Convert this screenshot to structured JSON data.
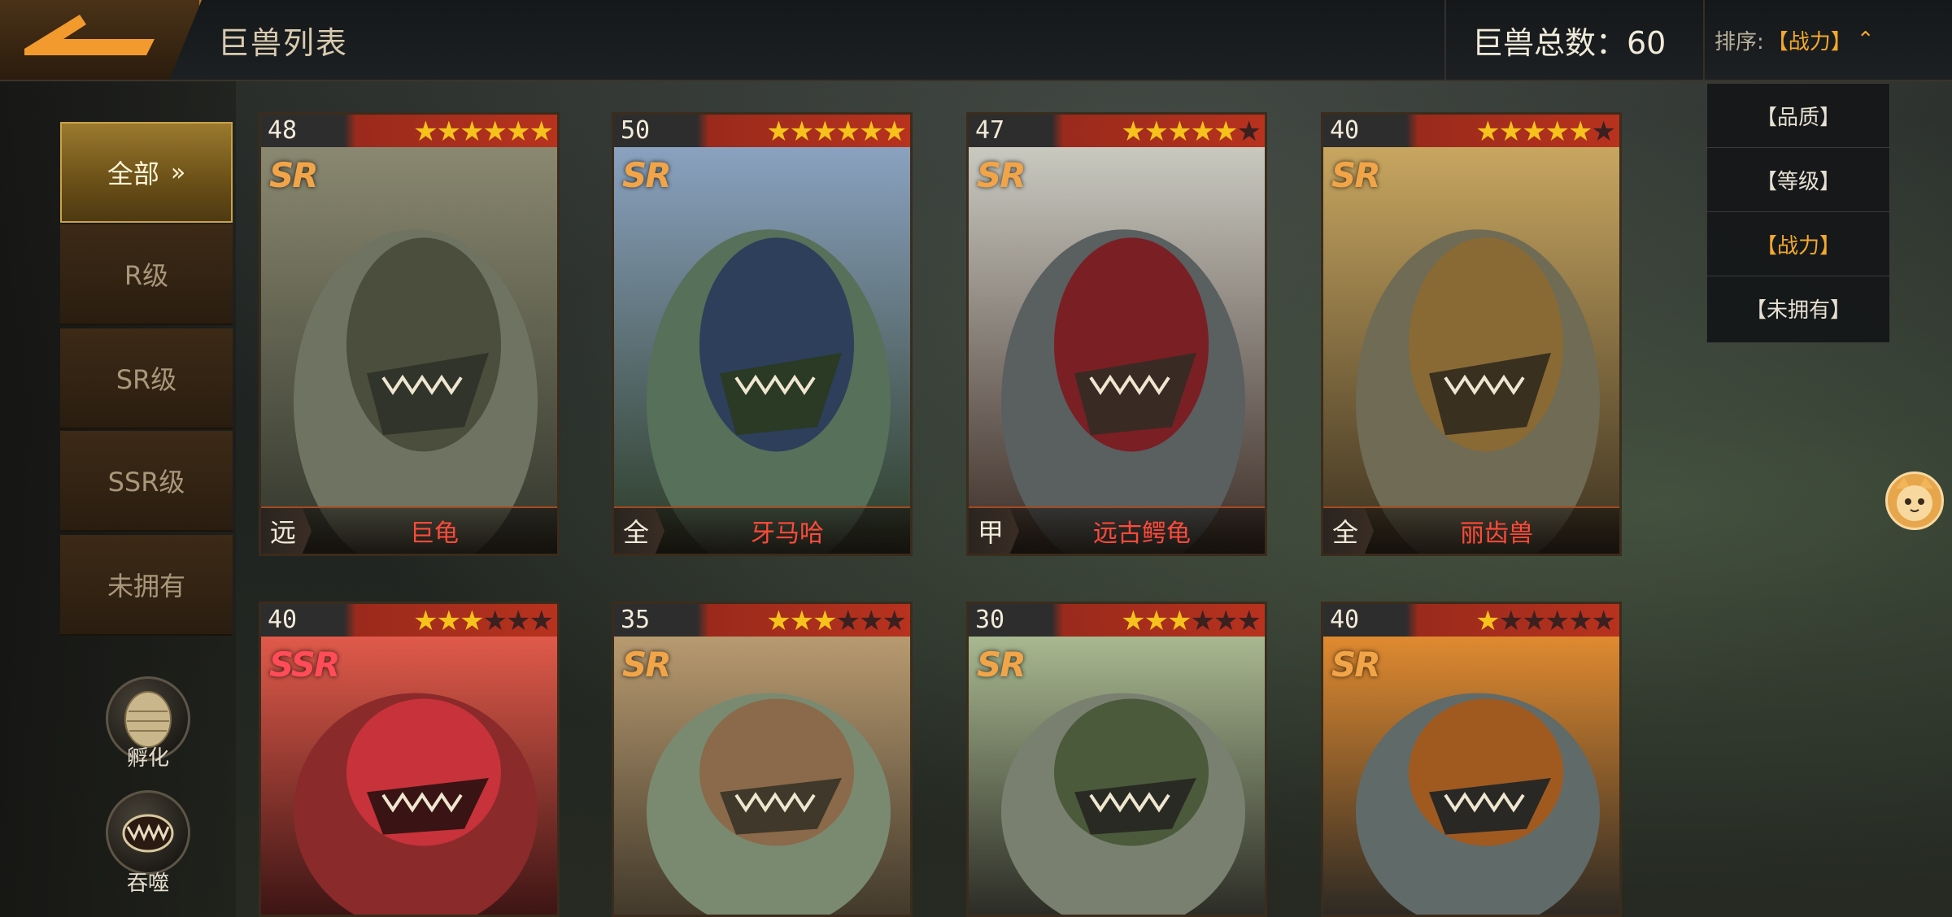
{
  "header": {
    "title": "巨兽列表",
    "total_label": "巨兽总数：60",
    "sort_label": "排序:",
    "sort_value": "【战力】"
  },
  "sort_menu": [
    {
      "label": "【品质】",
      "active": false
    },
    {
      "label": "【等级】",
      "active": false
    },
    {
      "label": "【战力】",
      "active": true
    },
    {
      "label": "【未拥有】",
      "active": false
    }
  ],
  "sidebar": {
    "items": [
      {
        "label": "全部",
        "active": true
      },
      {
        "label": "R级",
        "active": false
      },
      {
        "label": "SR级",
        "active": false
      },
      {
        "label": "SSR级",
        "active": false
      },
      {
        "label": "未拥有",
        "active": false
      }
    ],
    "hatch_label": "孵化",
    "devour_label": "吞噬"
  },
  "cards": [
    {
      "level": "48",
      "stars": 6,
      "rarity": "SR",
      "role": "远",
      "name": "巨龟"
    },
    {
      "level": "50",
      "stars": 6,
      "rarity": "SR",
      "role": "全",
      "name": "牙马哈"
    },
    {
      "level": "47",
      "stars": 5,
      "rarity": "SR",
      "role": "甲",
      "name": "远古鳄龟"
    },
    {
      "level": "40",
      "stars": 5,
      "rarity": "SR",
      "role": "全",
      "name": "丽齿兽"
    },
    {
      "level": "40",
      "stars": 3,
      "rarity": "SSR",
      "role": "",
      "name": ""
    },
    {
      "level": "35",
      "stars": 3,
      "rarity": "SR",
      "role": "",
      "name": ""
    },
    {
      "level": "30",
      "stars": 3,
      "rarity": "SR",
      "role": "",
      "name": ""
    },
    {
      "level": "40",
      "stars": 1,
      "rarity": "SR",
      "role": "",
      "name": ""
    }
  ],
  "colors": {
    "accent_gold": "#f4a82c",
    "name_red": "#ff4a3a",
    "star_on": "#f6c21c"
  }
}
